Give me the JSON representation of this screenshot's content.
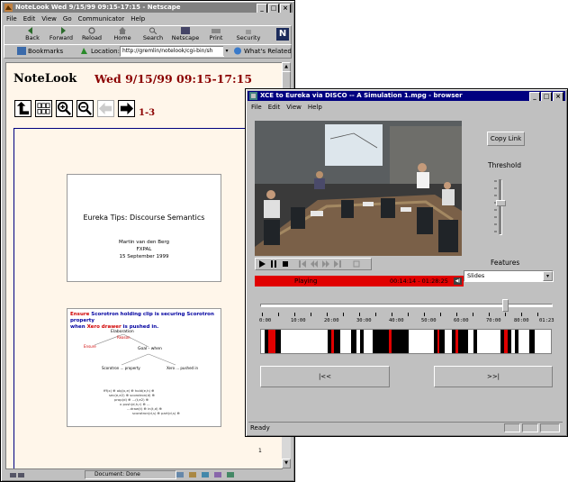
{
  "browser": {
    "title": "NoteLook Wed 9/15/99 09:15-17:15 - Netscape",
    "menu": [
      "File",
      "Edit",
      "View",
      "Go",
      "Communicator",
      "Help"
    ],
    "nav": [
      "Back",
      "Forward",
      "Reload",
      "Home",
      "Search",
      "Netscape",
      "Print",
      "Security"
    ],
    "bookmarks_label": "Bookmarks",
    "location_label": "Location:",
    "location_value": "http://gremlin/notelook/cgi-bin/sh",
    "related_label": "What's Related",
    "status": "Document: Done"
  },
  "notelook": {
    "app_name": "NoteLook",
    "session": "Wed 9/15/99 09:15-17:15",
    "range": "1-3",
    "page_number": "1",
    "slide1": {
      "title": "Eureka Tips: Discourse Semantics",
      "author": "Martin van den Berg",
      "org": "FXPAL",
      "date": "15 September 1999"
    },
    "slide2": {
      "heading_red1": "Ensure",
      "heading_blue1": "Scorotron holding clip is securing Scorotron property",
      "heading_blue2": "when",
      "heading_red2": "Xero drawer",
      "heading_blue3": "is pushed in.",
      "n_elaboration": "Elaboration",
      "n_reason": "Reason",
      "n_ensure": "Ensure",
      "n_goal": "Goal - when",
      "n_left": "Scorotron ... property",
      "n_right": "Xero ... pushed in",
      "formula": [
        "fff(x) ⊕ obj(x,e) ⊕ hold(e,h) ⊕",
        "sec(e,e2) ⊕ scorotron(d) ⊕",
        "prop(d) ⊕ ...(t,e2) ⊕",
        "x push(d,h,r) ⊕ ...",
        "...draw(t) ⊕ in(t,d) ⊕",
        "scorotron(d,s) ⊕ part(d,s) ⊕"
      ]
    }
  },
  "player": {
    "title": "XCE to Eureka via DISCO -- A Simulation 1.mpg - browser",
    "menu": [
      "File",
      "Edit",
      "View",
      "Help"
    ],
    "copy_link": "Copy Link",
    "threshold_label": "Threshold",
    "features_label": "Features",
    "features_value": "Slides",
    "playing": "Playing",
    "time": "00:14:14 - 01:28:25",
    "timeline_labels": [
      "0:00",
      "10:00",
      "20:00",
      "30:00",
      "40:00",
      "50:00",
      "60:00",
      "70:00",
      "80:00",
      "01:23"
    ],
    "prev_label": "|<<",
    "next_label": ">>|",
    "status": "Ready",
    "slider_position": 0.845,
    "threshold_level": 0.42
  },
  "colors": {
    "title_active": "#000080",
    "notelook_red": "#8b0000",
    "highlight_red": "#e00000"
  }
}
